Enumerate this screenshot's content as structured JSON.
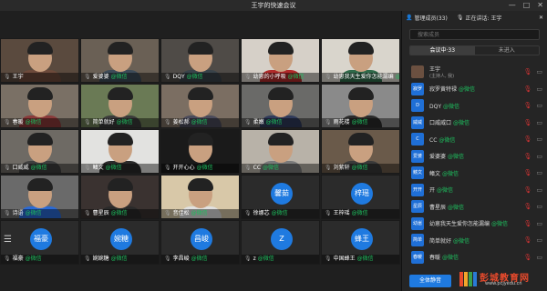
{
  "window": {
    "title": "王宇的快速会议",
    "controls": [
      "—",
      "□",
      "✕"
    ]
  },
  "tiles": [
    {
      "id": "t1",
      "caption": "王宇",
      "wx": "",
      "host": true,
      "bg": "#5a4a3e",
      "shirt": "#6d4a3b",
      "avatar": ""
    },
    {
      "id": "t2",
      "caption": "爱婆婆",
      "wx": "@微信",
      "bg": "#6a6055",
      "shirt": "#3d4b58",
      "avatar": ""
    },
    {
      "id": "t3",
      "caption": "DQY",
      "wx": "@微信",
      "bg": "#4f4b47",
      "shirt": "#39434a",
      "avatar": ""
    },
    {
      "id": "t4",
      "caption": "幼崽的小呼吸",
      "wx": "@微信",
      "bg": "#d6d0c8",
      "shirt": "#b02a2a",
      "avatar": ""
    },
    {
      "id": "t5",
      "caption": "幼崽我天生爱你怎能漏编",
      "wx": "@微信",
      "bg": "#d9d5cc",
      "shirt": "#2f6a4a",
      "avatar": ""
    },
    {
      "id": "t6",
      "caption": "春暖",
      "wx": "@微信",
      "bg": "#7a7065",
      "shirt": "#8a3a3a",
      "avatar": ""
    },
    {
      "id": "t7",
      "caption": "简单就好",
      "wx": "@微信",
      "bg": "#6a7a55",
      "shirt": "#3a3a3a",
      "avatar": ""
    },
    {
      "id": "t8",
      "caption": "姜松郝",
      "wx": "@微信",
      "bg": "#7b6e62",
      "shirt": "#4a4a5a",
      "avatar": ""
    },
    {
      "id": "t9",
      "caption": "柔嫩",
      "wx": "@微信",
      "bg": "#6a6a68",
      "shirt": "#2f3a5a",
      "avatar": ""
    },
    {
      "id": "t10",
      "caption": "雨花楼",
      "wx": "@微信",
      "bg": "#8a8a8a",
      "shirt": "#2a2a2a",
      "avatar": ""
    },
    {
      "id": "t11",
      "caption": "口威威",
      "wx": "@微信",
      "bg": "#6e6a64",
      "shirt": "#3f3f3f",
      "avatar": ""
    },
    {
      "id": "t12",
      "caption": "鳍文",
      "wx": "@微信",
      "bg": "#e2e2e0",
      "shirt": "#2a2a2a",
      "avatar": ""
    },
    {
      "id": "t13",
      "caption": "开开心心",
      "wx": "@微信",
      "bg": "#1a1a1a",
      "shirt": "#1a1a1a",
      "avatar": ""
    },
    {
      "id": "t14",
      "caption": "CC",
      "wx": "@微信",
      "bg": "#b8b2a8",
      "shirt": "#7a7a7a",
      "avatar": ""
    },
    {
      "id": "t15",
      "caption": "刘紫轩",
      "wx": "@微信",
      "bg": "#6a5a4a",
      "shirt": "#3a3a3a",
      "avatar": ""
    },
    {
      "id": "t16",
      "caption": "诗语",
      "wx": "@微信",
      "bg": "#6a6a6a",
      "shirt": "#2a6ad6",
      "avatar": ""
    },
    {
      "id": "t17",
      "caption": "曹星辰",
      "wx": "@微信",
      "bg": "#3a3230",
      "shirt": "#2a2a2a",
      "avatar": ""
    },
    {
      "id": "t18",
      "caption": "音佳松",
      "wx": "@微信",
      "bg": "#d8c8a8",
      "shirt": "#e0e0e0",
      "avatar": ""
    },
    {
      "id": "t19",
      "caption": "徐娜芯",
      "wx": "@微信",
      "bg": "#2b2b2b",
      "shirt": "#2b2b2b",
      "avatar": "馨茹"
    },
    {
      "id": "t20",
      "caption": "王梓瑶",
      "wx": "@微信",
      "bg": "#2b2b2b",
      "shirt": "#2b2b2b",
      "avatar": "梓瑶"
    },
    {
      "id": "t21",
      "caption": "福豪",
      "wx": "@微信",
      "bg": "#2b2b2b",
      "shirt": "#2b2b2b",
      "avatar": "福豪"
    },
    {
      "id": "t22",
      "caption": "婉婉糖",
      "wx": "@微信",
      "bg": "#2b2b2b",
      "shirt": "#2b2b2b",
      "avatar": "婉糖"
    },
    {
      "id": "t23",
      "caption": "李昌峻",
      "wx": "@微信",
      "bg": "#2b2b2b",
      "shirt": "#2b2b2b",
      "avatar": "昌峻"
    },
    {
      "id": "t24",
      "caption": "z",
      "wx": "@微信",
      "bg": "#2b2b2b",
      "shirt": "#2b2b2b",
      "avatar": "Z"
    },
    {
      "id": "t25",
      "caption": "中国蜂王",
      "wx": "@微信",
      "bg": "#2b2b2b",
      "shirt": "#2b2b2b",
      "avatar": "蜂王"
    }
  ],
  "panel": {
    "header": {
      "members": "管理成员(33)",
      "speaking": "正在讲话: 王宇"
    },
    "search_placeholder": "搜索成员",
    "tabs": [
      {
        "label": "会议中·33",
        "active": true
      },
      {
        "label": "未进入",
        "active": false
      }
    ],
    "participants": [
      {
        "name": "王宇",
        "sub": "(主持人, 我)",
        "wx": "",
        "avatar": "",
        "photo": true
      },
      {
        "name": "寂罗黄特禄",
        "wx": "@微信",
        "avatar": "寂罗"
      },
      {
        "name": "DQY",
        "wx": "@微信",
        "avatar": "D"
      },
      {
        "name": "口威威口",
        "wx": "@微信",
        "avatar": "威威"
      },
      {
        "name": "CC",
        "wx": "@微信",
        "avatar": "C"
      },
      {
        "name": "爱婆婆",
        "wx": "@微信",
        "avatar": "爱婆"
      },
      {
        "name": "鳍文",
        "wx": "@微信",
        "avatar": "鳍文"
      },
      {
        "name": "开",
        "wx": "@微信",
        "avatar": "开开"
      },
      {
        "name": "曹星辰",
        "wx": "@微信",
        "avatar": "星辰"
      },
      {
        "name": "幼崽我天生爱你怎能漏编",
        "wx": "@微信",
        "avatar": "幼崽"
      },
      {
        "name": "简单就好",
        "wx": "@微信",
        "avatar": "简单"
      },
      {
        "name": "春暖",
        "wx": "@微信",
        "avatar": "春暖"
      }
    ],
    "mute_all": "全体静音"
  },
  "logo": {
    "text": "彭城教育网",
    "url": "www.pcjyedu.cn"
  },
  "colors": {
    "accent": "#1f7ae0",
    "wechat": "#1ec05f",
    "muted": "#cc3333"
  }
}
